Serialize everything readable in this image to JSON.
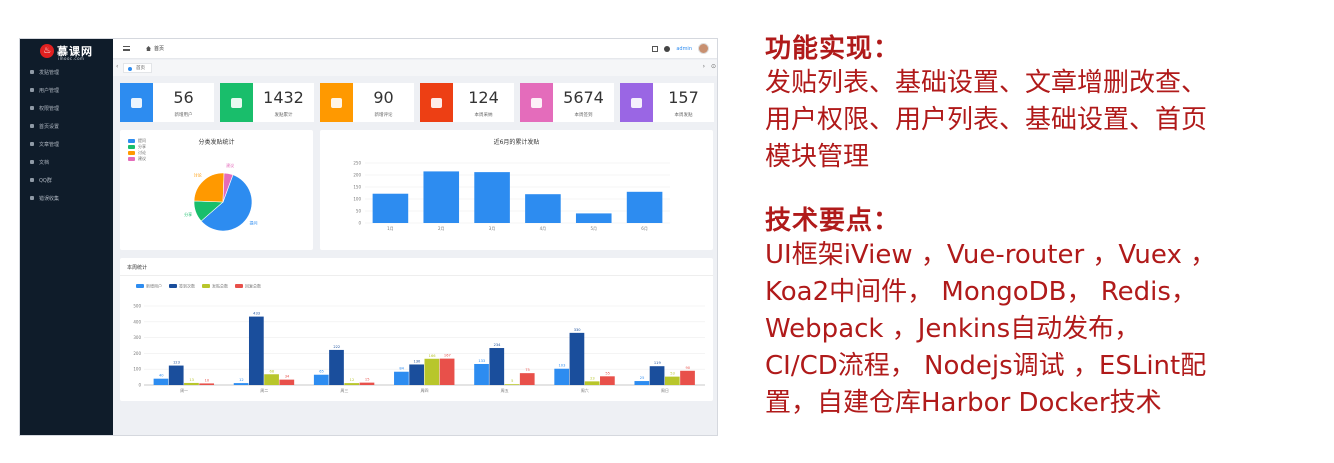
{
  "sidebar": {
    "logo_text": "慕课网",
    "logo_sub": "imooc.com",
    "items": [
      {
        "label": "发贴管理"
      },
      {
        "label": "用户管理"
      },
      {
        "label": "权限管理"
      },
      {
        "label": "首页设置"
      },
      {
        "label": "文章管理"
      },
      {
        "label": "文档"
      },
      {
        "label": "QQ群"
      },
      {
        "label": "错误收集"
      }
    ]
  },
  "topbar": {
    "breadcrumb": "首页",
    "user_label": "admin"
  },
  "tabs": [
    {
      "label": "首页"
    }
  ],
  "stats": [
    {
      "value": "56",
      "label": "新增用户",
      "color": "#2d8cf0"
    },
    {
      "value": "1432",
      "label": "发贴累计",
      "color": "#19be6b"
    },
    {
      "value": "90",
      "label": "新增评论",
      "color": "#ff9900"
    },
    {
      "value": "124",
      "label": "本周采纳",
      "color": "#ed3f14"
    },
    {
      "value": "5674",
      "label": "本周签到",
      "color": "#e46cbb"
    },
    {
      "value": "157",
      "label": "本周发贴",
      "color": "#9a66e4"
    }
  ],
  "chart_data": [
    {
      "type": "pie",
      "title": "分类发贴统计",
      "legend": [
        "提问",
        "分享",
        "讨论",
        "建议"
      ],
      "values": [
        58,
        12,
        25,
        5
      ],
      "colors": [
        "#2d8cf0",
        "#19be6b",
        "#ff9900",
        "#e46cbb"
      ],
      "legend_position": "top-left"
    },
    {
      "type": "bar",
      "title": "近6月的累计发贴",
      "categories": [
        "1月",
        "2月",
        "3月",
        "4月",
        "5月",
        "6月"
      ],
      "values": [
        122,
        215,
        212,
        120,
        40,
        130
      ],
      "ylim": [
        0,
        250
      ],
      "yticks": [
        0,
        50,
        100,
        150,
        200,
        250
      ],
      "color": "#2d8cf0"
    },
    {
      "type": "bar",
      "title": "本周统计",
      "categories": [
        "周一",
        "周二",
        "周三",
        "周四",
        "周五",
        "周六",
        "周日"
      ],
      "ylim": [
        0,
        500
      ],
      "yticks": [
        0,
        100,
        200,
        300,
        400,
        500
      ],
      "series": [
        {
          "name": "新增用户",
          "color": "#2d8cf0",
          "values": [
            40,
            12,
            65,
            84,
            133,
            103,
            25
          ]
        },
        {
          "name": "签到次数",
          "color": "#1a4e9c",
          "values": [
            123,
            433,
            222,
            130,
            234,
            330,
            119
          ]
        },
        {
          "name": "发贴总数",
          "color": "#b8c62b",
          "values": [
            13,
            68,
            12,
            166,
            5,
            23,
            53
          ]
        },
        {
          "name": "回复总数",
          "color": "#e8504a",
          "values": [
            10,
            34,
            15,
            167,
            75,
            55,
            90
          ]
        }
      ],
      "legend_position": "top-left"
    }
  ],
  "slide": {
    "section1_title": "功能实现：",
    "section1_lines": [
      "发贴列表、基础设置、文章增删改查、",
      "用户权限、用户列表、基础设置、首页",
      "模块管理"
    ],
    "section2_title": "技术要点：",
    "section2_lines": [
      "UI框架iView ，Vue-router ，Vuex ，",
      "Koa2中间件， MongoDB， Redis，",
      "Webpack ，Jenkins自动发布，",
      "CI/CD流程， Nodejs调试 ，ESLint配",
      "置，自建仓库Harbor Docker技术"
    ]
  }
}
